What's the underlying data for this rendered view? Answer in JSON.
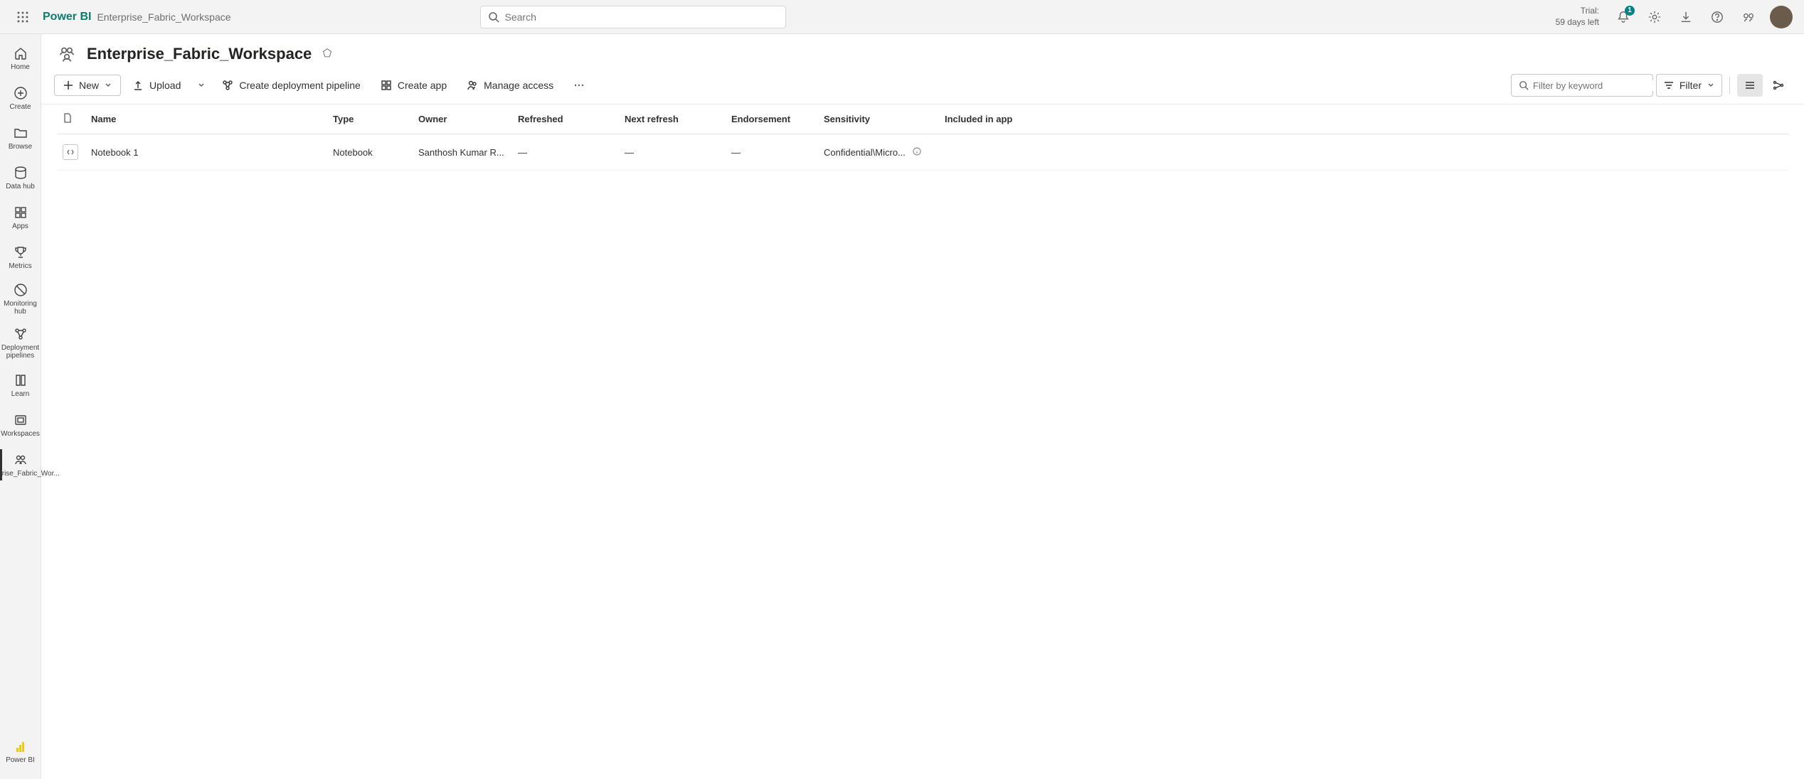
{
  "header": {
    "brand": "Power BI",
    "breadcrumb": "Enterprise_Fabric_Workspace",
    "search_placeholder": "Search",
    "trial_label": "Trial:",
    "trial_days": "59 days left",
    "notification_count": "1"
  },
  "nav": {
    "items": [
      {
        "label": "Home"
      },
      {
        "label": "Create"
      },
      {
        "label": "Browse"
      },
      {
        "label": "Data hub"
      },
      {
        "label": "Apps"
      },
      {
        "label": "Metrics"
      },
      {
        "label": "Monitoring hub"
      },
      {
        "label": "Deployment pipelines"
      },
      {
        "label": "Learn"
      },
      {
        "label": "Workspaces"
      },
      {
        "label": "Enterprise_Fabric_Wor..."
      }
    ],
    "bottom_label": "Power BI"
  },
  "workspace": {
    "title": "Enterprise_Fabric_Workspace"
  },
  "toolbar": {
    "new_label": "New",
    "upload_label": "Upload",
    "pipeline_label": "Create deployment pipeline",
    "app_label": "Create app",
    "access_label": "Manage access",
    "filter_placeholder": "Filter by keyword",
    "filter_label": "Filter"
  },
  "table": {
    "columns": {
      "name": "Name",
      "type": "Type",
      "owner": "Owner",
      "refreshed": "Refreshed",
      "next_refresh": "Next refresh",
      "endorsement": "Endorsement",
      "sensitivity": "Sensitivity",
      "included": "Included in app"
    },
    "rows": [
      {
        "name": "Notebook 1",
        "type": "Notebook",
        "owner": "Santhosh Kumar R...",
        "refreshed": "—",
        "next_refresh": "—",
        "endorsement": "—",
        "sensitivity": "Confidential\\Micro...",
        "included": ""
      }
    ]
  }
}
